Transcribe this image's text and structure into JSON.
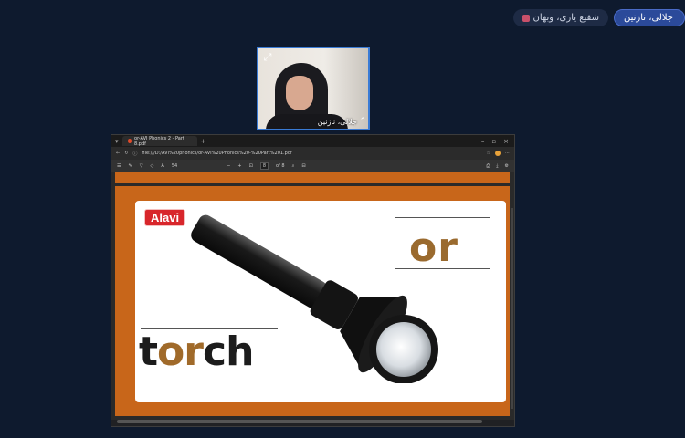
{
  "participants": {
    "active": {
      "name": "جلالی، نازنین"
    },
    "other": {
      "name": "شفیع یاری، وبهان"
    }
  },
  "video": {
    "name": "جلالی، نازنین",
    "expand_icon": "⤢",
    "more_icon": "⌃"
  },
  "browser": {
    "tab_title": "or-AVI Phonics 2 - Part 8.pdf",
    "url": "file:///D:/AVI%20phonics/or-AVI%20Phonics%20-%20Part%201.pdf",
    "page_value": "8",
    "page_total": "of 8",
    "zoom": "54"
  },
  "slide": {
    "brand": "Alavi",
    "key_sound": "or",
    "word": {
      "pre": "t",
      "hl": "or",
      "post": "ch"
    },
    "colors": {
      "orange": "#c8661a",
      "brown": "#9a6a2e",
      "red": "#d8262b"
    }
  }
}
